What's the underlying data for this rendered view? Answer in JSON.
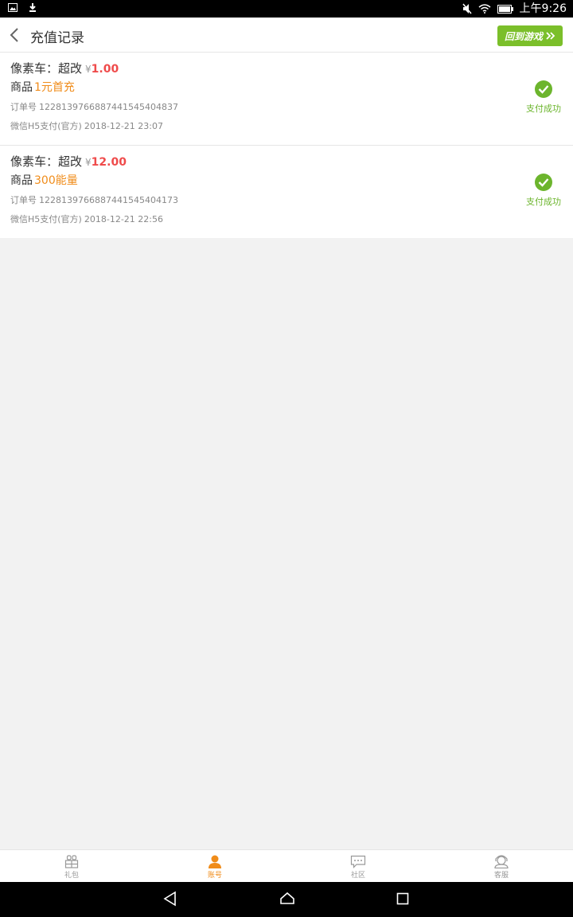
{
  "status_bar": {
    "time": "上午9:26"
  },
  "header": {
    "title": "充值记录",
    "back_to_game": "回到游戏"
  },
  "records": [
    {
      "game": "像素车：超改",
      "currency": "¥",
      "amount": "1.00",
      "product_label": "商品",
      "product": "1元首充",
      "order_label": "订单号",
      "order_no": "1228139766887441545404837",
      "pay_method": "微信H5支付(官方)",
      "time": "2018-12-21 23:07",
      "status": "支付成功"
    },
    {
      "game": "像素车：超改",
      "currency": "¥",
      "amount": "12.00",
      "product_label": "商品",
      "product": "300能量",
      "order_label": "订单号",
      "order_no": "1228139766887441545404173",
      "pay_method": "微信H5支付(官方)",
      "time": "2018-12-21 22:56",
      "status": "支付成功"
    }
  ],
  "tabbar": [
    {
      "label": "礼包",
      "icon": "gift-icon",
      "active": false
    },
    {
      "label": "账号",
      "icon": "user-icon",
      "active": true
    },
    {
      "label": "社区",
      "icon": "chat-icon",
      "active": false
    },
    {
      "label": "客服",
      "icon": "headset-icon",
      "active": false
    }
  ],
  "colors": {
    "accent": "#f08c1a",
    "success": "#6cb52d",
    "amount": "#ef4b4b",
    "game_button": "#7bbf2a"
  }
}
